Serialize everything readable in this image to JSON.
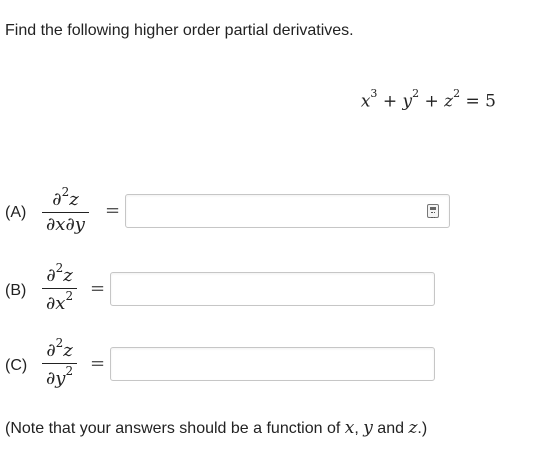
{
  "question": {
    "prompt": "Find the following higher order partial derivatives."
  },
  "equation": {
    "x": "x",
    "x_exp": "3",
    "plus1": "+",
    "y": "y",
    "y_exp": "2",
    "plus2": "+",
    "z": "z",
    "z_exp": "2",
    "equals": "=",
    "rhs": "5"
  },
  "parts": [
    {
      "label": "(A)",
      "num_partial": "∂",
      "num_exp": "2",
      "num_var": "z",
      "den_text": "∂x∂y",
      "den_exp": "",
      "equals": "=",
      "answer": ""
    },
    {
      "label": "(B)",
      "num_partial": "∂",
      "num_exp": "2",
      "num_var": "z",
      "den_text": "∂x",
      "den_exp": "2",
      "equals": "=",
      "answer": ""
    },
    {
      "label": "(C)",
      "num_partial": "∂",
      "num_exp": "2",
      "num_var": "z",
      "den_text": "∂y",
      "den_exp": "2",
      "equals": "=",
      "answer": ""
    }
  ],
  "note": {
    "prefix": "(Note that your answers should be a function of ",
    "var_x": "x",
    "sep1": ", ",
    "var_y": "y",
    "sep2": " and ",
    "var_z": "z",
    "suffix": ".)"
  },
  "icons": {
    "equation_editor": "equation-editor-icon"
  }
}
